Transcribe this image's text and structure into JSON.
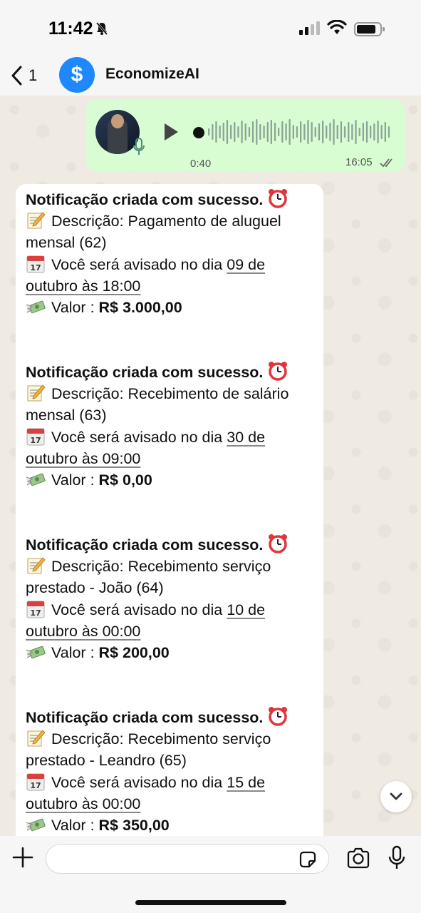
{
  "status_bar": {
    "time": "11:42",
    "icons": [
      "bell-off-icon",
      "signal-icon",
      "wifi-icon",
      "battery-icon"
    ]
  },
  "header": {
    "back_count": "1",
    "avatar_symbol": "$",
    "contact_name": "EconomizeAI",
    "avatar_color": "#1e88ff"
  },
  "voice_message": {
    "duration": "0:40",
    "time": "16:05",
    "status": "read"
  },
  "notifications": [
    {
      "title": "Notificação criada com sucesso.",
      "description_label": "Descrição: Pagamento de aluguel",
      "description_cont": "mensal (62)",
      "alert_prefix": "Você será avisado no dia",
      "alert_date_1": "09 de",
      "alert_date_2": "outubro às 18:00",
      "value_label": "Valor :",
      "value": "R$ 3.000,00"
    },
    {
      "title": "Notificação criada com sucesso.",
      "description_label": "Descrição: Recebimento de salário",
      "description_cont": "mensal (63)",
      "alert_prefix": "Você será avisado no dia",
      "alert_date_1": "30 de",
      "alert_date_2": "outubro às 09:00",
      "value_label": "Valor :",
      "value": "R$ 0,00"
    },
    {
      "title": "Notificação criada com sucesso.",
      "description_label": "Descrição: Recebimento serviço",
      "description_cont": "prestado - João (64)",
      "alert_prefix": "Você será avisado no dia",
      "alert_date_1": "10 de",
      "alert_date_2": "outubro às 00:00",
      "value_label": "Valor :",
      "value": "R$ 200,00"
    },
    {
      "title": "Notificação criada com sucesso.",
      "description_label": "Descrição: Recebimento serviço",
      "description_cont": "prestado - Leandro (65)",
      "alert_prefix": "Você será avisado no dia",
      "alert_date_1": "15 de",
      "alert_date_2": "outubro às 00:00",
      "value_label": "Valor :",
      "value": "R$ 350,00"
    }
  ],
  "colors": {
    "outgoing_bubble": "#d9fdd3",
    "incoming_bubble": "#ffffff",
    "chat_background": "#efeae2"
  }
}
